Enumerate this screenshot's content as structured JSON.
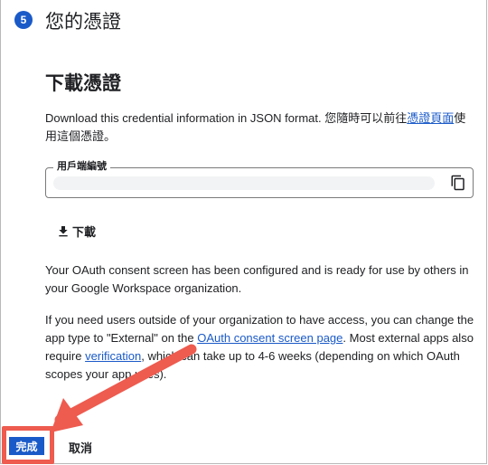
{
  "step": {
    "number": "5",
    "title": "您的憑證"
  },
  "section": {
    "title": "下載憑證",
    "intro_before": "Download this credential information in JSON format. 您隨時可以前往",
    "intro_link": "憑證頁面",
    "intro_after": "使用這個憑證。"
  },
  "client_id_field": {
    "label": "用戶端編號",
    "value": ""
  },
  "download_button": {
    "label": "下載"
  },
  "notes": {
    "p1": "Your OAuth consent screen has been configured and is ready for use by others in your Google Workspace organization.",
    "p2_part1": "If you need users outside of your organization to have access, you can change the app type to \"External\" on the ",
    "p2_link1": "OAuth consent screen page",
    "p2_part2": ". Most external apps also require ",
    "p2_link2": "verification",
    "p2_part3": ", which can take up to 4-6 weeks (depending on which OAuth scopes your app uses)."
  },
  "actions": {
    "done_label": "完成",
    "cancel_label": "取消"
  },
  "colors": {
    "accent": "#1a5ac8",
    "annotation": "#ee5b4f"
  }
}
